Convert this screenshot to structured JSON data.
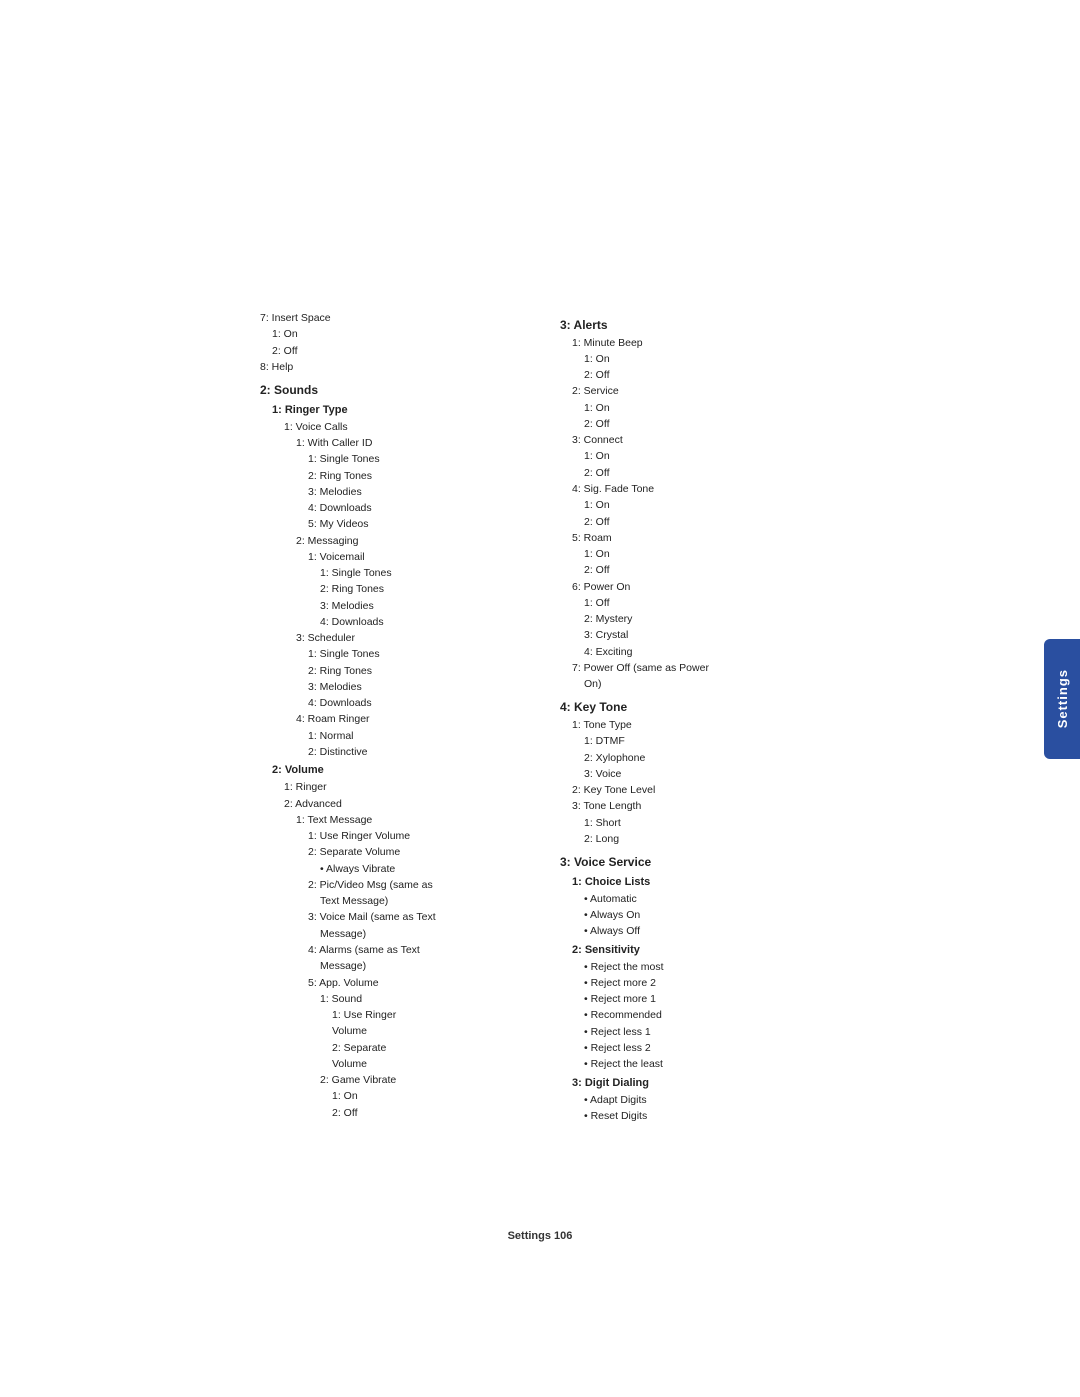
{
  "left_column": {
    "items": [
      {
        "level": 0,
        "text": "7: Insert Space"
      },
      {
        "level": 1,
        "text": "1: On"
      },
      {
        "level": 1,
        "text": "2: Off"
      },
      {
        "level": 0,
        "text": "8: Help"
      },
      {
        "level": 0,
        "text": "2: Sounds",
        "bold": true
      },
      {
        "level": 1,
        "text": "1: Ringer Type",
        "bold": true
      },
      {
        "level": 2,
        "text": "1: Voice Calls"
      },
      {
        "level": 3,
        "text": "1: With Caller ID"
      },
      {
        "level": 4,
        "text": "1: Single Tones"
      },
      {
        "level": 4,
        "text": "2: Ring Tones"
      },
      {
        "level": 4,
        "text": "3: Melodies"
      },
      {
        "level": 4,
        "text": "4: Downloads"
      },
      {
        "level": 4,
        "text": "5: My Videos"
      },
      {
        "level": 3,
        "text": "2: Messaging"
      },
      {
        "level": 4,
        "text": "1: Voicemail"
      },
      {
        "level": 5,
        "text": "1: Single Tones"
      },
      {
        "level": 5,
        "text": "2: Ring Tones"
      },
      {
        "level": 5,
        "text": "3: Melodies"
      },
      {
        "level": 5,
        "text": "4: Downloads"
      },
      {
        "level": 3,
        "text": "3: Scheduler"
      },
      {
        "level": 4,
        "text": "1: Single Tones"
      },
      {
        "level": 4,
        "text": "2: Ring Tones"
      },
      {
        "level": 4,
        "text": "3: Melodies"
      },
      {
        "level": 4,
        "text": "4: Downloads"
      },
      {
        "level": 3,
        "text": "4: Roam Ringer"
      },
      {
        "level": 4,
        "text": "1: Normal"
      },
      {
        "level": 4,
        "text": "2: Distinctive"
      },
      {
        "level": 1,
        "text": "2: Volume",
        "bold": true
      },
      {
        "level": 2,
        "text": "1: Ringer"
      },
      {
        "level": 2,
        "text": "2: Advanced"
      },
      {
        "level": 3,
        "text": "1: Text Message"
      },
      {
        "level": 4,
        "text": "1: Use Ringer Volume"
      },
      {
        "level": 4,
        "text": "2: Separate Volume"
      },
      {
        "level": 5,
        "text": "• Always Vibrate"
      },
      {
        "level": 4,
        "text": "2: Pic/Video Msg (same as"
      },
      {
        "level": 5,
        "text": "Text Message)"
      },
      {
        "level": 4,
        "text": "3: Voice Mail (same as Text"
      },
      {
        "level": 5,
        "text": "Message)"
      },
      {
        "level": 4,
        "text": "4: Alarms (same as Text"
      },
      {
        "level": 5,
        "text": "Message)"
      },
      {
        "level": 4,
        "text": "5: App. Volume"
      },
      {
        "level": 5,
        "text": "1: Sound"
      },
      {
        "level": 6,
        "text": "1: Use Ringer"
      },
      {
        "level": 6,
        "text": "Volume"
      },
      {
        "level": 6,
        "text": "2: Separate"
      },
      {
        "level": 6,
        "text": "Volume"
      },
      {
        "level": 5,
        "text": "2: Game Vibrate"
      },
      {
        "level": 6,
        "text": "1: On"
      },
      {
        "level": 6,
        "text": "2: Off"
      }
    ]
  },
  "right_column": {
    "items": [
      {
        "level": 0,
        "text": "3: Alerts",
        "bold": true
      },
      {
        "level": 1,
        "text": "1: Minute Beep"
      },
      {
        "level": 2,
        "text": "1: On"
      },
      {
        "level": 2,
        "text": "2: Off"
      },
      {
        "level": 1,
        "text": "2: Service"
      },
      {
        "level": 2,
        "text": "1: On"
      },
      {
        "level": 2,
        "text": "2: Off"
      },
      {
        "level": 1,
        "text": "3: Connect"
      },
      {
        "level": 2,
        "text": "1: On"
      },
      {
        "level": 2,
        "text": "2: Off"
      },
      {
        "level": 1,
        "text": "4: Sig. Fade Tone"
      },
      {
        "level": 2,
        "text": "1: On"
      },
      {
        "level": 2,
        "text": "2: Off"
      },
      {
        "level": 1,
        "text": "5: Roam"
      },
      {
        "level": 2,
        "text": "1: On"
      },
      {
        "level": 2,
        "text": "2: Off"
      },
      {
        "level": 1,
        "text": "6: Power On"
      },
      {
        "level": 2,
        "text": "1: Off"
      },
      {
        "level": 2,
        "text": "2: Mystery"
      },
      {
        "level": 2,
        "text": "3: Crystal"
      },
      {
        "level": 2,
        "text": "4: Exciting"
      },
      {
        "level": 1,
        "text": "7: Power Off (same as Power"
      },
      {
        "level": 2,
        "text": "On)"
      },
      {
        "level": 0,
        "text": "4: Key Tone",
        "bold": true
      },
      {
        "level": 1,
        "text": "1: Tone Type"
      },
      {
        "level": 2,
        "text": "1: DTMF"
      },
      {
        "level": 2,
        "text": "2: Xylophone"
      },
      {
        "level": 2,
        "text": "3: Voice"
      },
      {
        "level": 1,
        "text": "2: Key Tone Level"
      },
      {
        "level": 1,
        "text": "3: Tone Length"
      },
      {
        "level": 2,
        "text": "1: Short"
      },
      {
        "level": 2,
        "text": "2: Long"
      },
      {
        "level": 0,
        "text": "3: Voice Service",
        "bold": true
      },
      {
        "level": 1,
        "text": "1: Choice Lists",
        "bold": true
      },
      {
        "level": 2,
        "text": "• Automatic"
      },
      {
        "level": 2,
        "text": "• Always On"
      },
      {
        "level": 2,
        "text": "• Always Off"
      },
      {
        "level": 1,
        "text": "2: Sensitivity",
        "bold": true
      },
      {
        "level": 2,
        "text": "• Reject the most"
      },
      {
        "level": 2,
        "text": "• Reject more 2"
      },
      {
        "level": 2,
        "text": "• Reject more 1"
      },
      {
        "level": 2,
        "text": "• Recommended"
      },
      {
        "level": 2,
        "text": "• Reject less 1"
      },
      {
        "level": 2,
        "text": "• Reject less 2"
      },
      {
        "level": 2,
        "text": "• Reject the least"
      },
      {
        "level": 1,
        "text": "3: Digit Dialing",
        "bold": true
      },
      {
        "level": 2,
        "text": "• Adapt Digits"
      },
      {
        "level": 2,
        "text": "• Reset Digits"
      }
    ]
  },
  "settings_tab": {
    "label": "Settings"
  },
  "footer": {
    "text": "Settings   106"
  }
}
